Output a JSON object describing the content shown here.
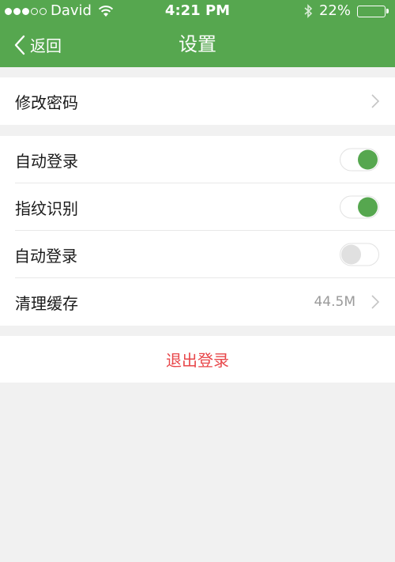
{
  "status_bar": {
    "carrier": "David",
    "time": "4:21 PM",
    "battery": "22%",
    "battery_level": 0.22
  },
  "nav": {
    "back_label": "返回",
    "title": "设置"
  },
  "rows": {
    "change_password": "修改密码",
    "auto_login_1": "自动登录",
    "fingerprint": "指纹识别",
    "auto_login_2": "自动登录",
    "clear_cache": "清理缓存",
    "cache_size": "44.5M"
  },
  "toggles": {
    "auto_login_1": true,
    "fingerprint": true,
    "auto_login_2": false
  },
  "logout_label": "退出登录",
  "colors": {
    "primary": "#56a74f",
    "logout": "#e8474a",
    "background": "#f1f1f1"
  }
}
